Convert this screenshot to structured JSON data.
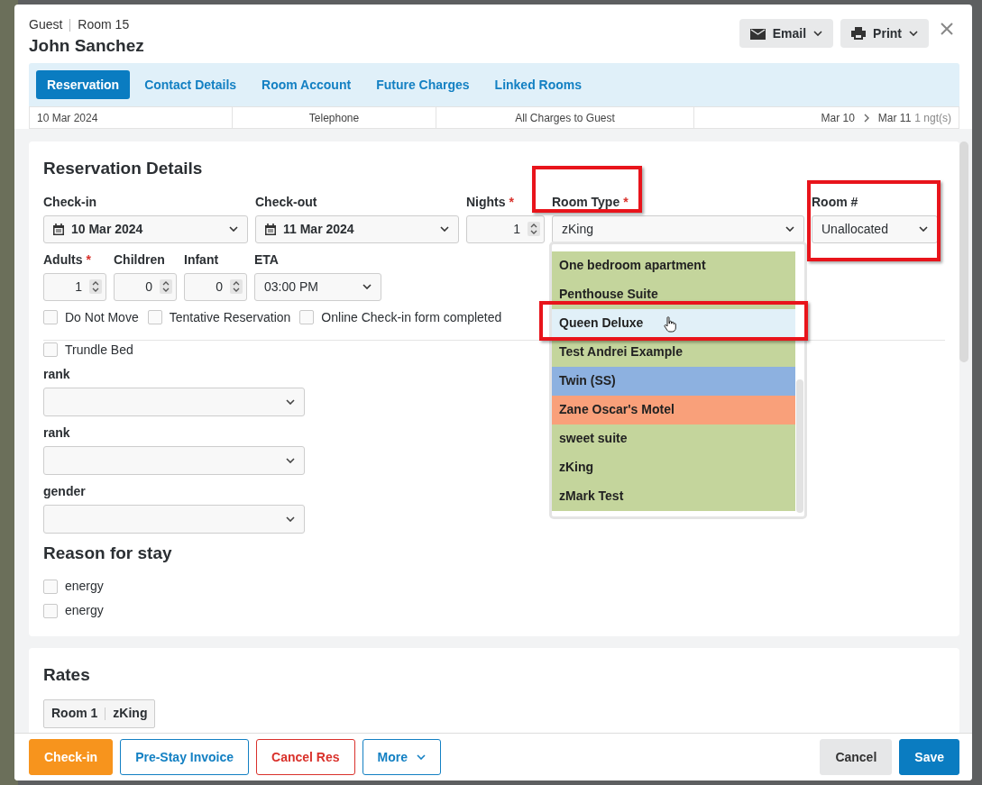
{
  "header": {
    "category": "Guest",
    "room": "Room 15",
    "guest_name": "John Sanchez",
    "buttons": [
      {
        "label": "Email",
        "kind": "email"
      },
      {
        "label": "Print",
        "kind": "print"
      }
    ]
  },
  "tabs": [
    {
      "label": "Reservation",
      "selected": true
    },
    {
      "label": "Contact Details",
      "selected": false
    },
    {
      "label": "Room Account",
      "selected": false
    },
    {
      "label": "Future Charges",
      "selected": false
    },
    {
      "label": "Linked Rooms",
      "selected": false
    }
  ],
  "info_strip": {
    "booked": "10 Mar 2024",
    "source": "Telephone",
    "billing": "All Charges to Guest",
    "arrival": "Mar 10",
    "departure": "Mar 11",
    "nights": "1 ngt(s)"
  },
  "reservation": {
    "title": "Reservation Details",
    "row_1": [
      {
        "kind": "date",
        "label": "Check-in",
        "value": "10 Mar 2024"
      },
      {
        "kind": "date",
        "label": "Check-out",
        "value": "11 Mar 2024"
      },
      {
        "kind": "number",
        "label": "Nights",
        "required_mark": "*",
        "value": "1"
      },
      {
        "kind": "select",
        "label": "Room Type",
        "required_mark": "*",
        "value": "zKing",
        "label_annotated": true,
        "dropdown_open": true
      },
      {
        "kind": "select",
        "label": "Room #",
        "value": "Unallocated",
        "field_annotated": true
      }
    ],
    "row_2": [
      {
        "kind": "number",
        "label": "Adults",
        "required_mark": "*",
        "value": "1"
      },
      {
        "kind": "number",
        "label": "Children",
        "value": "0"
      },
      {
        "kind": "number",
        "label": "Infant",
        "value": "0"
      },
      {
        "kind": "select",
        "label": "ETA",
        "value": "03:00 PM"
      }
    ],
    "flags": [
      {
        "label": "Do Not Move",
        "checked": false
      },
      {
        "label": "Tentative Reservation",
        "checked": false
      },
      {
        "label": "Online Check-in form completed",
        "checked": false
      }
    ],
    "trundle": {
      "label": "Trundle Bed",
      "checked": false
    },
    "custom_selects": [
      {
        "label": "rank"
      },
      {
        "label": "rank"
      },
      {
        "label": "gender"
      }
    ],
    "reason_title": "Reason for stay",
    "reasons": [
      {
        "label": "energy",
        "checked": false
      },
      {
        "label": "energy",
        "checked": false
      }
    ]
  },
  "room_type_options": [
    {
      "label": "One bedroom apartment",
      "color": "#c4d59c",
      "highlighted": false,
      "annotated": false
    },
    {
      "label": "Penthouse Suite",
      "color": "#c4d59c",
      "highlighted": false,
      "annotated": false
    },
    {
      "label": "Queen Deluxe",
      "color": "#e1f0f8",
      "highlighted": true,
      "annotated": true
    },
    {
      "label": "Test Andrei Example",
      "color": "#c4d59c",
      "highlighted": false,
      "annotated": false
    },
    {
      "label": "Twin (SS)",
      "color": "#8db1e0",
      "highlighted": false,
      "annotated": false
    },
    {
      "label": "Zane Oscar's Motel",
      "color": "#f9a07a",
      "highlighted": false,
      "annotated": false
    },
    {
      "label": "sweet suite",
      "color": "#c4d59c",
      "highlighted": false,
      "annotated": false
    },
    {
      "label": "zKing",
      "color": "#c4d59c",
      "highlighted": false,
      "annotated": false
    },
    {
      "label": "zMark Test",
      "color": "#c4d59c",
      "highlighted": false,
      "annotated": false
    }
  ],
  "rates": {
    "title": "Rates",
    "room_tag": [
      "Room 1",
      "zKing"
    ]
  },
  "footer": {
    "left": [
      {
        "label": "Check-in",
        "kind": "solid-orange"
      },
      {
        "label": "Pre-Stay Invoice",
        "kind": "outline-blue"
      },
      {
        "label": "Cancel Res",
        "kind": "outline-red"
      },
      {
        "label": "More",
        "kind": "outline-blue-caret"
      }
    ],
    "right": [
      {
        "label": "Cancel",
        "kind": "solid-grey"
      },
      {
        "label": "Save",
        "kind": "solid-blue"
      }
    ]
  }
}
